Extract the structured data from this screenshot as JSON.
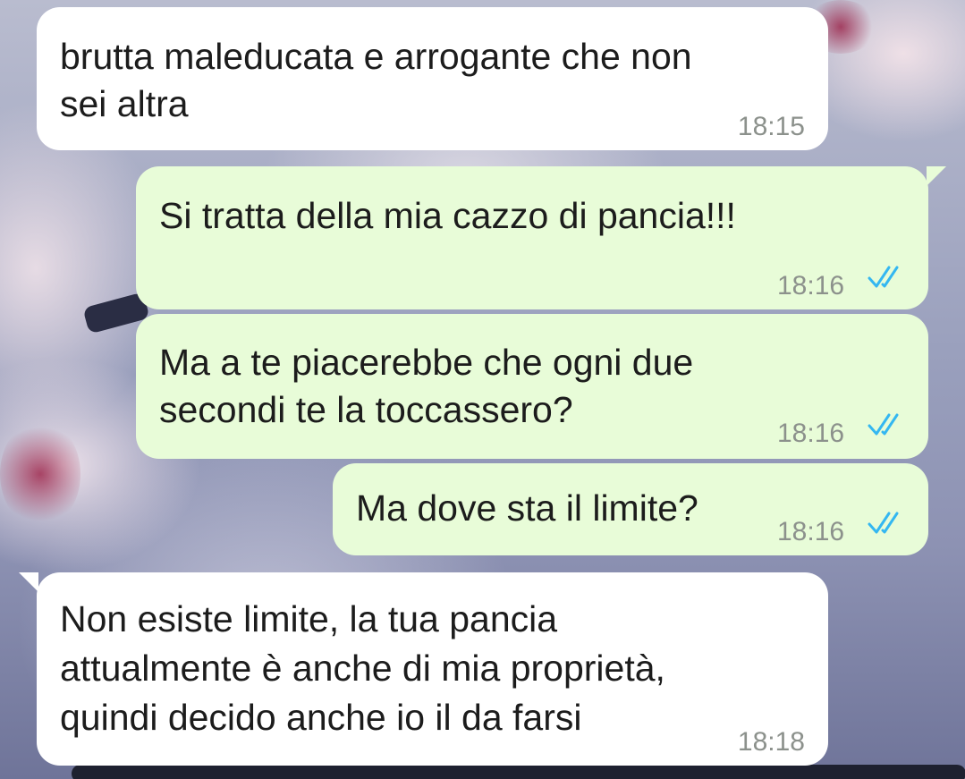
{
  "messages": [
    {
      "direction": "incoming",
      "lines": [
        "brutta maleducata e arrogante che non",
        "sei altra"
      ],
      "time": "18:15"
    },
    {
      "direction": "outgoing",
      "lines": [
        "Si tratta della mia cazzo di pancia!!!"
      ],
      "time": "18:16",
      "status": "read"
    },
    {
      "direction": "outgoing",
      "lines": [
        "Ma a te piacerebbe che ogni due",
        "secondi te la toccassero?"
      ],
      "time": "18:16",
      "status": "read"
    },
    {
      "direction": "outgoing",
      "lines": [
        "Ma dove sta il limite?"
      ],
      "time": "18:16",
      "status": "read"
    },
    {
      "direction": "incoming",
      "lines": [
        "Non esiste limite, la tua pancia",
        "attualmente è anche di mia proprietà,",
        "quindi decido anche io il da farsi"
      ],
      "time": "18:18"
    }
  ],
  "colors": {
    "incoming_bubble": "#ffffff",
    "outgoing_bubble": "#e8fcd8",
    "read_ticks": "#34b7f1",
    "time_text": "#8c918c"
  },
  "icons": {
    "read_status": "double-check-icon",
    "wallpaper": "cherry-blossom-wallpaper"
  }
}
